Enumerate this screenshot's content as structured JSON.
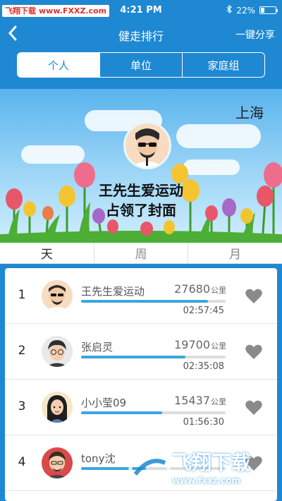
{
  "watermark": {
    "label": "飞翔下载",
    "url": "www.FXXZ.com",
    "logo_text": "飞翔下载",
    "logo_url": "www.fxxz.com"
  },
  "status": {
    "time": "4:21 PM",
    "battery": "22%"
  },
  "nav": {
    "back_icon": "chevron-left-icon",
    "title": "健走排行",
    "share": "一键分享"
  },
  "segments": [
    {
      "label": "个人",
      "active": true
    },
    {
      "label": "单位",
      "active": false
    },
    {
      "label": "家庭组",
      "active": false
    }
  ],
  "banner": {
    "city": "上海",
    "line1": "王先生爱运动",
    "line2": "占领了封面"
  },
  "periods": [
    {
      "label": "天",
      "active": true
    },
    {
      "label": "周",
      "active": false
    },
    {
      "label": "月",
      "active": false
    }
  ],
  "ranking": [
    {
      "rank": "1",
      "name": "王先生爱运动",
      "distance": "27680",
      "unit": "公里",
      "time": "02:57:45",
      "progress": 0.88
    },
    {
      "rank": "2",
      "name": "张启灵",
      "distance": "19700",
      "unit": "公里",
      "time": "02:35:08",
      "progress": 0.72
    },
    {
      "rank": "3",
      "name": "小小莹09",
      "distance": "15437",
      "unit": "公里",
      "time": "01:56:30",
      "progress": 0.56
    },
    {
      "rank": "4",
      "name": "tony沈",
      "distance": "",
      "unit": "",
      "time": "",
      "progress": 0.45
    }
  ],
  "colors": {
    "primary": "#1e88d3",
    "progress": "#3aa6df",
    "heart": "#8a8a8a"
  }
}
